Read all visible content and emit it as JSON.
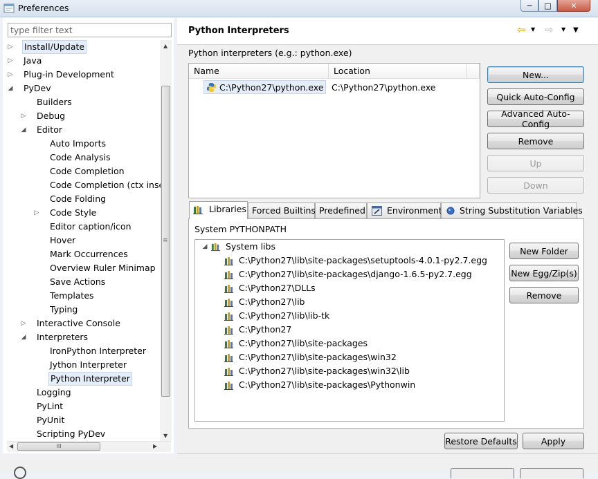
{
  "window": {
    "title": "Preferences"
  },
  "filter": {
    "placeholder": "type filter text"
  },
  "tree": [
    {
      "label": "Install/Update",
      "depth": 0,
      "twist": "closed",
      "selected": true
    },
    {
      "label": "Java",
      "depth": 0,
      "twist": "closed"
    },
    {
      "label": "Plug-in Development",
      "depth": 0,
      "twist": "closed"
    },
    {
      "label": "PyDev",
      "depth": 0,
      "twist": "open"
    },
    {
      "label": "Builders",
      "depth": 1,
      "twist": "none"
    },
    {
      "label": "Debug",
      "depth": 1,
      "twist": "closed"
    },
    {
      "label": "Editor",
      "depth": 1,
      "twist": "open"
    },
    {
      "label": "Auto Imports",
      "depth": 2,
      "twist": "none"
    },
    {
      "label": "Code Analysis",
      "depth": 2,
      "twist": "none"
    },
    {
      "label": "Code Completion",
      "depth": 2,
      "twist": "none"
    },
    {
      "label": "Code Completion (ctx inser",
      "depth": 2,
      "twist": "none"
    },
    {
      "label": "Code Folding",
      "depth": 2,
      "twist": "none"
    },
    {
      "label": "Code Style",
      "depth": 2,
      "twist": "closed"
    },
    {
      "label": "Editor caption/icon",
      "depth": 2,
      "twist": "none"
    },
    {
      "label": "Hover",
      "depth": 2,
      "twist": "none"
    },
    {
      "label": "Mark Occurrences",
      "depth": 2,
      "twist": "none"
    },
    {
      "label": "Overview Ruler Minimap",
      "depth": 2,
      "twist": "none"
    },
    {
      "label": "Save Actions",
      "depth": 2,
      "twist": "none"
    },
    {
      "label": "Templates",
      "depth": 2,
      "twist": "none"
    },
    {
      "label": "Typing",
      "depth": 2,
      "twist": "none"
    },
    {
      "label": "Interactive Console",
      "depth": 1,
      "twist": "closed"
    },
    {
      "label": "Interpreters",
      "depth": 1,
      "twist": "open"
    },
    {
      "label": "IronPython Interpreter",
      "depth": 2,
      "twist": "none"
    },
    {
      "label": "Jython Interpreter",
      "depth": 2,
      "twist": "none"
    },
    {
      "label": "Python Interpreter",
      "depth": 2,
      "twist": "none",
      "selected": true
    },
    {
      "label": "Logging",
      "depth": 1,
      "twist": "none"
    },
    {
      "label": "PyLint",
      "depth": 1,
      "twist": "none"
    },
    {
      "label": "PyUnit",
      "depth": 1,
      "twist": "none"
    },
    {
      "label": "Scripting PyDev",
      "depth": 1,
      "twist": "none"
    }
  ],
  "page": {
    "title": "Python Interpreters",
    "description": "Python interpreters (e.g.: python.exe)"
  },
  "interpreters": {
    "columns": {
      "name": "Name",
      "location": "Location"
    },
    "rows": [
      {
        "name": "C:\\Python27\\python.exe",
        "location": "C:\\Python27\\python.exe"
      }
    ]
  },
  "buttons": {
    "new": "New...",
    "quick_auto_config": "Quick Auto-Config",
    "advanced_auto_config": "Advanced Auto-Config",
    "remove": "Remove",
    "up": "Up",
    "down": "Down"
  },
  "tabs": [
    "Libraries",
    "Forced Builtins",
    "Predefined",
    "Environment",
    "String Substitution Variables"
  ],
  "libraries": {
    "label": "System PYTHONPATH",
    "root": "System libs",
    "paths": [
      "C:\\Python27\\lib\\site-packages\\setuptools-4.0.1-py2.7.egg",
      "C:\\Python27\\lib\\site-packages\\django-1.6.5-py2.7.egg",
      "C:\\Python27\\DLLs",
      "C:\\Python27\\lib",
      "C:\\Python27\\lib\\lib-tk",
      "C:\\Python27",
      "C:\\Python27\\lib\\site-packages",
      "C:\\Python27\\lib\\site-packages\\win32",
      "C:\\Python27\\lib\\site-packages\\win32\\lib",
      "C:\\Python27\\lib\\site-packages\\Pythonwin"
    ],
    "buttons": {
      "new_folder": "New Folder",
      "new_egg": "New Egg/Zip(s)",
      "remove": "Remove"
    }
  },
  "footer": {
    "restore_defaults": "Restore Defaults",
    "apply": "Apply"
  },
  "icons": {
    "app": "preferences-icon",
    "back": "back-arrow-icon",
    "forward": "forward-arrow-icon"
  },
  "colors": {
    "selection": "#e5eef8",
    "background": "#f0f0f0"
  }
}
